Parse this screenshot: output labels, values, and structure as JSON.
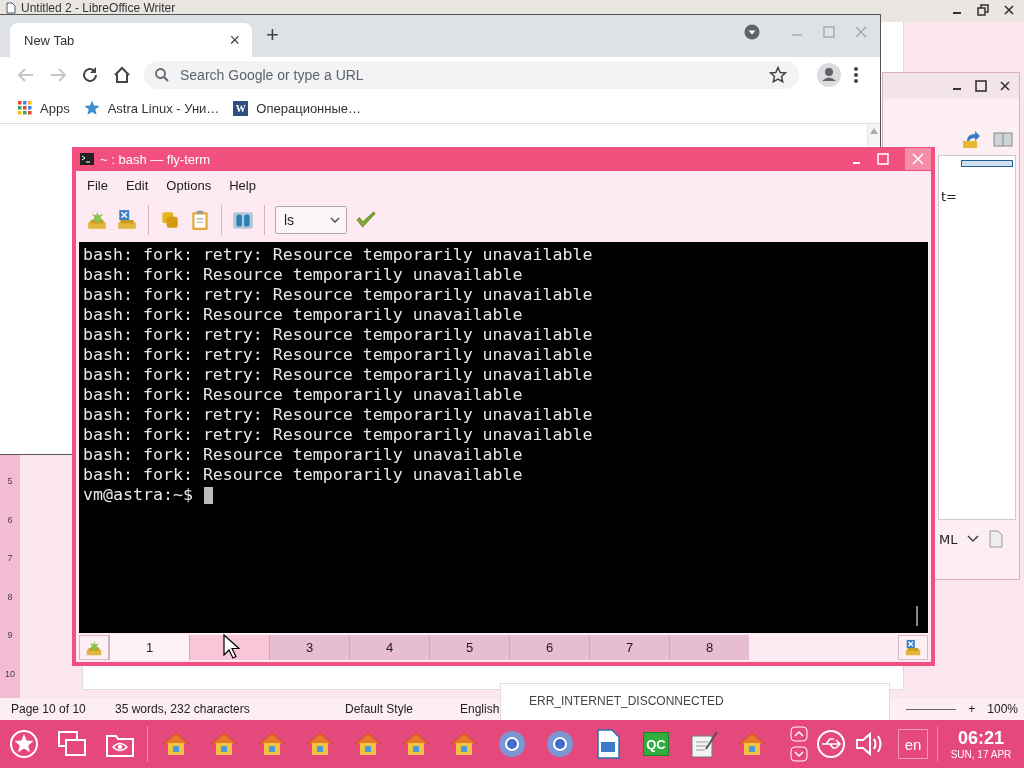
{
  "writer_window": {
    "title": "Untitled 2 - LibreOffice Writer",
    "ruler_numbers": [
      "5",
      "6",
      "7",
      "8",
      "9",
      "10"
    ],
    "status_bar": {
      "page": "Page 10 of 10",
      "words": "35 words, 232 characters",
      "style": "Default Style",
      "language": "English",
      "zoom_in": "+",
      "zoom": "100%"
    }
  },
  "side_window": {
    "field_text": "t=",
    "format": "ML"
  },
  "browser": {
    "tab": {
      "label": "New Tab",
      "close": "×"
    },
    "new_tab": "+",
    "address_placeholder": "Search Google or type a URL",
    "bookmarks": [
      {
        "kind": "apps",
        "label": "Apps"
      },
      {
        "kind": "star",
        "label": "Astra Linux - Уни…"
      },
      {
        "kind": "letter",
        "icon_letter": "W",
        "label": "Операционные…"
      }
    ]
  },
  "error_window": {
    "text": "ERR_INTERNET_DISCONNECTED"
  },
  "terminal": {
    "title": "~ : bash — fly-term",
    "menu": [
      "File",
      "Edit",
      "Options",
      "Help"
    ],
    "command": "ls",
    "lines": [
      "bash: fork: retry: Resource temporarily unavailable",
      "bash: fork: Resource temporarily unavailable",
      "bash: fork: retry: Resource temporarily unavailable",
      "bash: fork: Resource temporarily unavailable",
      "bash: fork: retry: Resource temporarily unavailable",
      "bash: fork: retry: Resource temporarily unavailable",
      "bash: fork: retry: Resource temporarily unavailable",
      "bash: fork: Resource temporarily unavailable",
      "bash: fork: retry: Resource temporarily unavailable",
      "bash: fork: retry: Resource temporarily unavailable",
      "bash: fork: Resource temporarily unavailable",
      "bash: fork: Resource temporarily unavailable"
    ],
    "prompt": "vm@astra:~$",
    "tabs": [
      {
        "label": "1",
        "selected": true,
        "hovered": false
      },
      {
        "selected": false,
        "hovered": true
      },
      {
        "label": "3",
        "selected": false,
        "hovered": false
      },
      {
        "label": "4",
        "selected": false,
        "hovered": false
      },
      {
        "label": "5",
        "selected": false,
        "hovered": false
      },
      {
        "label": "6",
        "selected": false,
        "hovered": false
      },
      {
        "label": "7",
        "selected": false,
        "hovered": false
      },
      {
        "label": "8",
        "selected": false,
        "hovered": false
      }
    ]
  },
  "taskbar": {
    "apps": [
      {
        "kind": "house"
      },
      {
        "kind": "house"
      },
      {
        "kind": "house"
      },
      {
        "kind": "house"
      },
      {
        "kind": "house"
      },
      {
        "kind": "house"
      },
      {
        "kind": "house"
      },
      {
        "kind": "browser"
      },
      {
        "kind": "browser"
      },
      {
        "kind": "document"
      },
      {
        "kind": "badge",
        "label": "QC"
      },
      {
        "kind": "notepad"
      },
      {
        "kind": "house"
      }
    ],
    "language": "en",
    "time": "06:21",
    "date": "SUN, 17 APR"
  }
}
